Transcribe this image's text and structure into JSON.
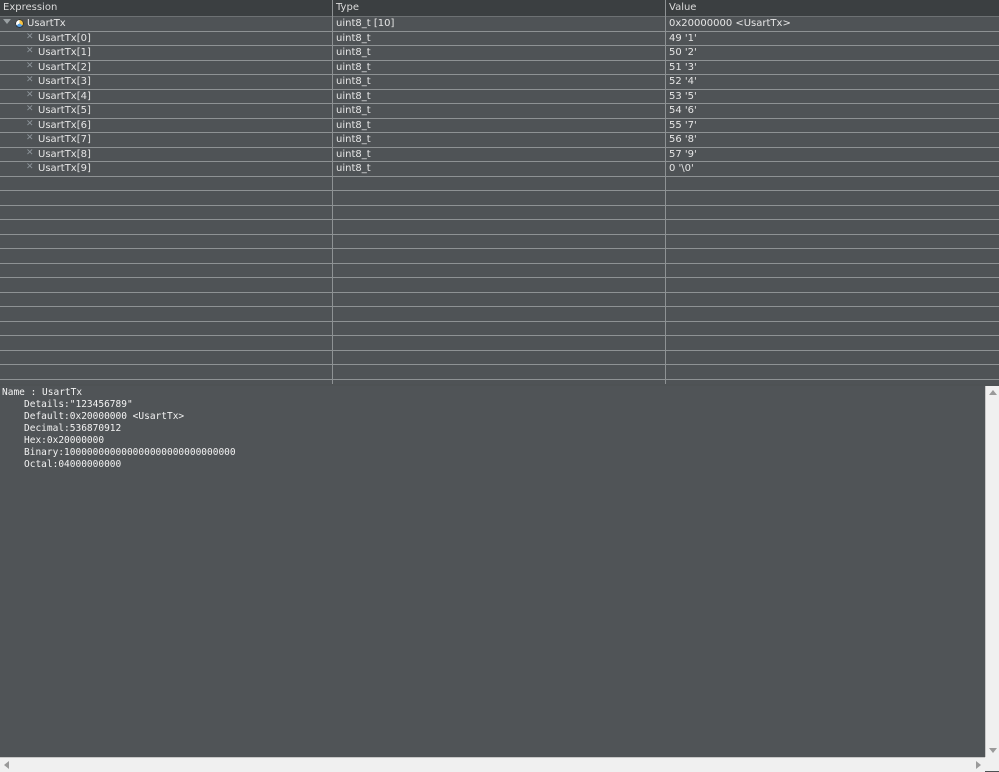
{
  "columns": {
    "expression": "Expression",
    "type": "Type",
    "value": "Value"
  },
  "root": {
    "name": "UsartTx",
    "type": "uint8_t [10]",
    "value": "0x20000000 <UsartTx>",
    "expanded": true
  },
  "children": [
    {
      "name": "UsartTx[0]",
      "type": "uint8_t",
      "value": "49 '1'"
    },
    {
      "name": "UsartTx[1]",
      "type": "uint8_t",
      "value": "50 '2'"
    },
    {
      "name": "UsartTx[2]",
      "type": "uint8_t",
      "value": "51 '3'"
    },
    {
      "name": "UsartTx[3]",
      "type": "uint8_t",
      "value": "52 '4'"
    },
    {
      "name": "UsartTx[4]",
      "type": "uint8_t",
      "value": "53 '5'"
    },
    {
      "name": "UsartTx[5]",
      "type": "uint8_t",
      "value": "54 '6'"
    },
    {
      "name": "UsartTx[6]",
      "type": "uint8_t",
      "value": "55 '7'"
    },
    {
      "name": "UsartTx[7]",
      "type": "uint8_t",
      "value": "56 '8'"
    },
    {
      "name": "UsartTx[8]",
      "type": "uint8_t",
      "value": "57 '9'"
    },
    {
      "name": "UsartTx[9]",
      "type": "uint8_t",
      "value": "0 '\\0'"
    }
  ],
  "details": {
    "name_line": "Name : UsartTx",
    "lines": [
      "Details:\"123456789\"",
      "Default:0x20000000 <UsartTx>",
      "Decimal:536870912",
      "Hex:0x20000000",
      "Binary:100000000000000000000000000000",
      "Octal:04000000000"
    ]
  },
  "icons": {
    "root": "variable-icon",
    "child": "field-icon",
    "expander": "chevron-down-icon"
  },
  "colors": {
    "background": "#4e5254",
    "header": "#3b3f41",
    "gridline": "#8e9294",
    "text": "#e6e6e6",
    "scrollbar": "#f0f0f0"
  }
}
